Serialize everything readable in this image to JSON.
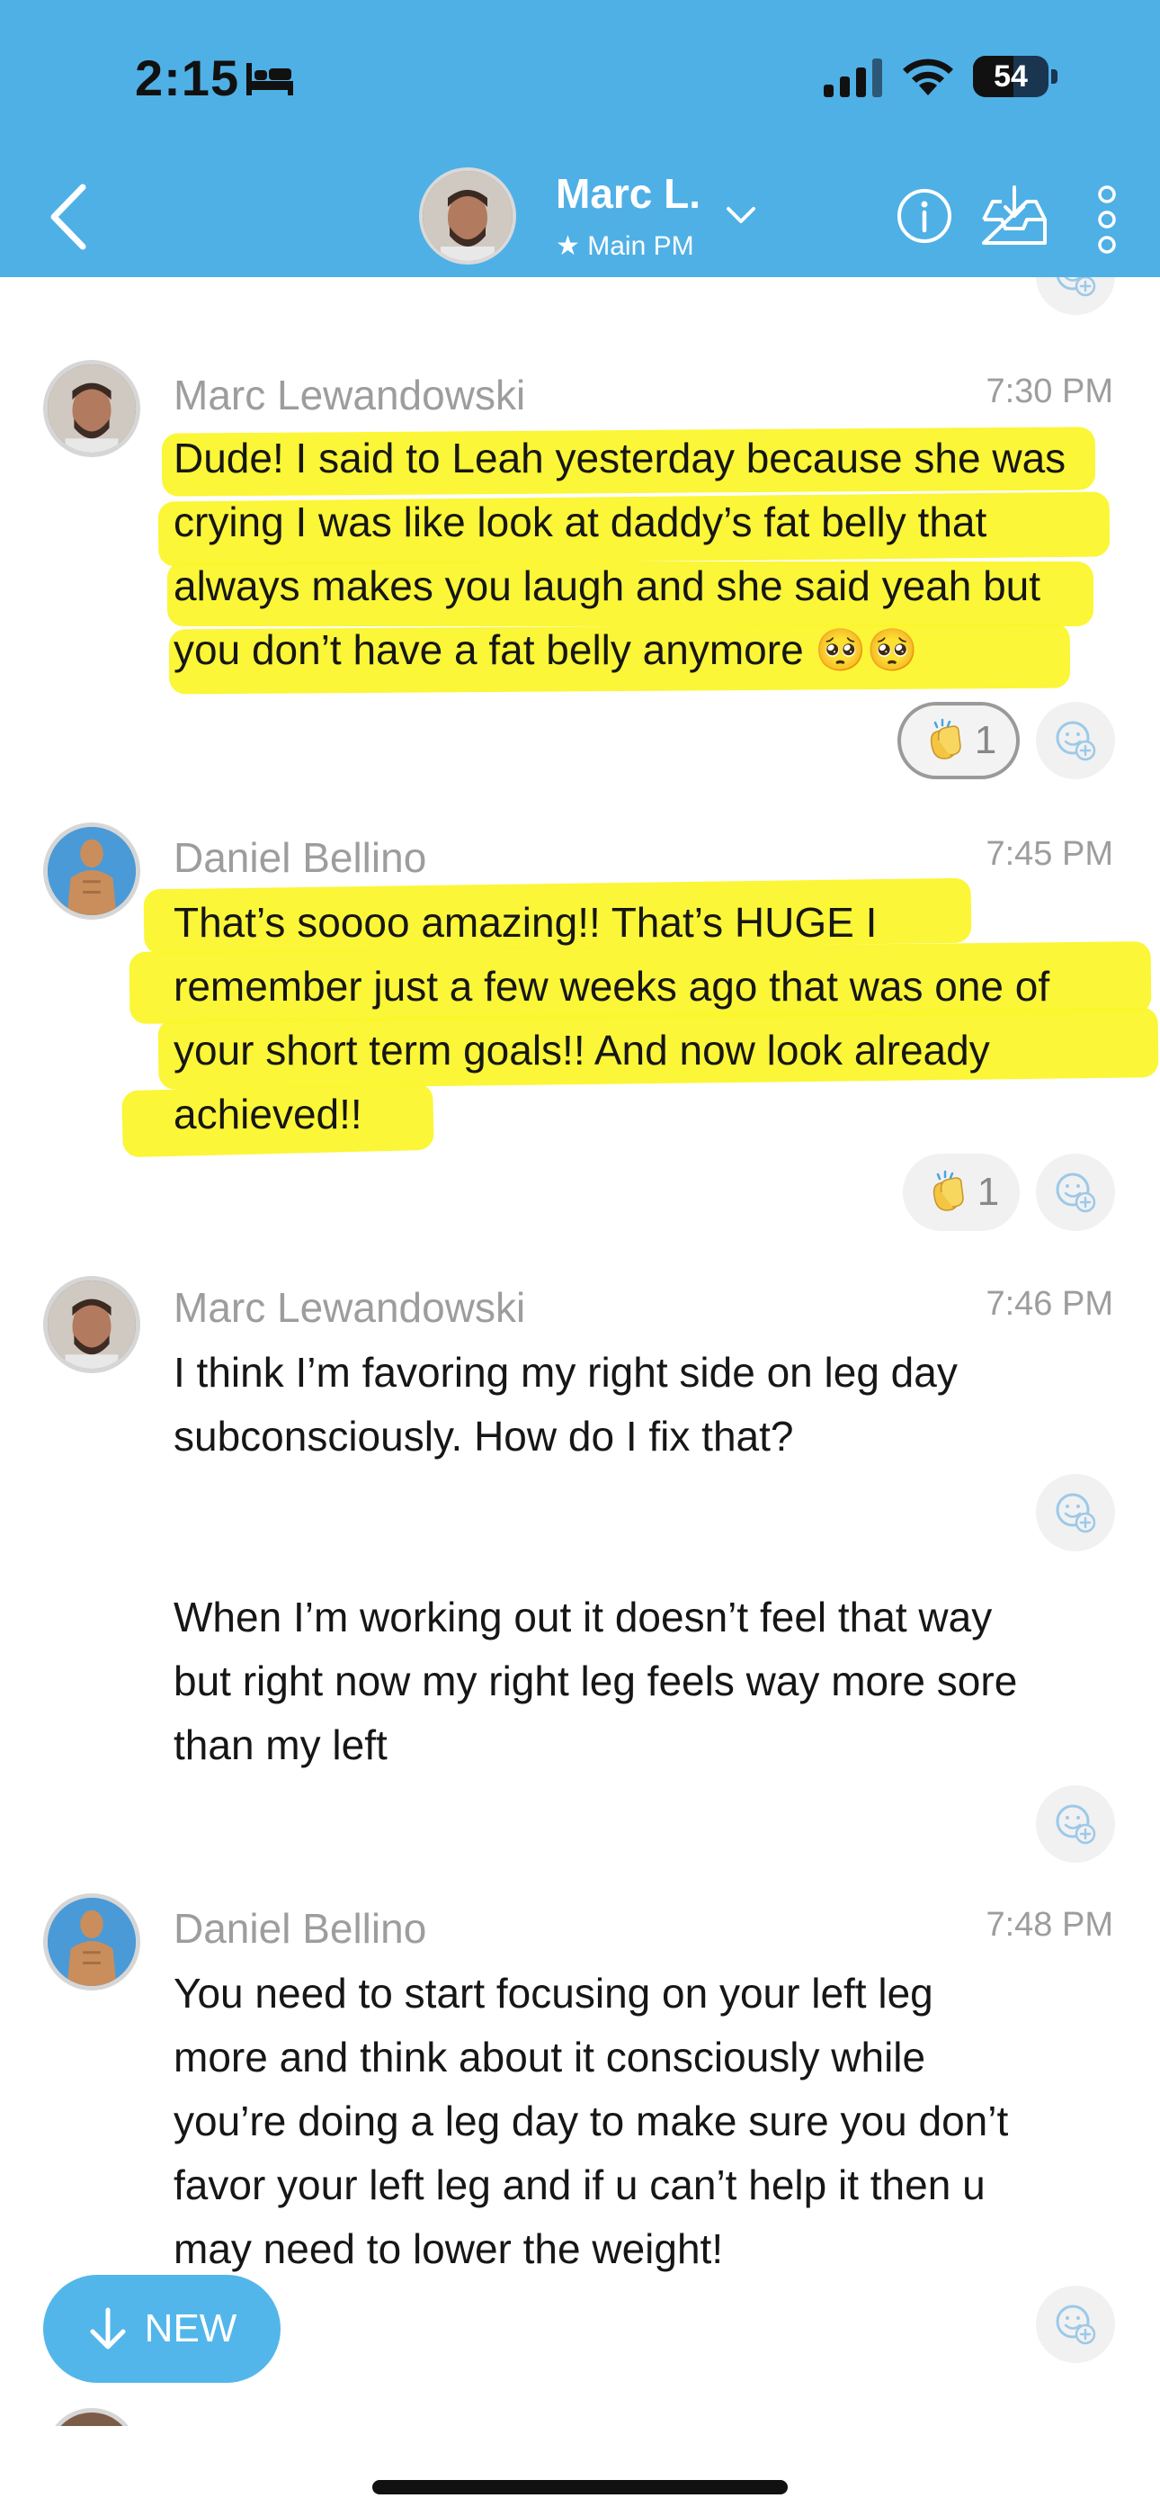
{
  "status_bar": {
    "time": "2:15",
    "battery": "54",
    "battery_level": 0.54
  },
  "header": {
    "contact_name": "Marc L.",
    "subtitle": "★ Main PM"
  },
  "messages": [
    {
      "sender": "Marc Lewandowski",
      "time": "7:30 PM",
      "lines": [
        "Dude! I said to Leah yesterday because she was",
        "crying I was like look at daddy’s fat belly that",
        "always makes you laugh and she said yeah but",
        "you don’t have a fat belly anymore 🥺🥺"
      ],
      "reaction_count": "1"
    },
    {
      "sender": "Daniel Bellino",
      "time": "7:45 PM",
      "lines": [
        "That’s soooo amazing!! That’s HUGE I",
        "remember just a few weeks ago that was one of",
        "your short term goals!! And now look already",
        "achieved!!"
      ],
      "reaction_count": "1"
    },
    {
      "sender": "Marc Lewandowski",
      "time": "7:46 PM",
      "lines": [
        "I think I’m favoring my right side on leg day",
        "subconsciously. How do I fix that?"
      ],
      "followup_lines": [
        "When I’m working out it doesn’t feel that way",
        "but right now my right leg feels way more sore",
        "than my left"
      ]
    },
    {
      "sender": "Daniel Bellino",
      "time": "7:48 PM",
      "lines": [
        "You need to start focusing on your left leg",
        "more and think about it consciously while",
        "you’re doing a leg day to make sure you don’t",
        "favor your left leg and if u can’t help it then u",
        "may need to lower the weight!"
      ]
    }
  ],
  "new_button": {
    "label": "NEW"
  },
  "colors": {
    "header_bg": "#4fb0e6",
    "highlight": "#fbf62c",
    "new_button_bg": "#53b6ea",
    "meta_text": "#9d9d9d"
  },
  "icons": {
    "status": [
      "bed-icon",
      "signal-icon",
      "wifi-icon",
      "battery-icon"
    ],
    "header": [
      "back-icon",
      "chevron-down-icon",
      "info-icon",
      "inbox-download-icon",
      "more-vertical-icon"
    ],
    "reactions": [
      "clapping-hands-icon",
      "add-reaction-icon"
    ],
    "new_button": "arrow-down-icon"
  }
}
